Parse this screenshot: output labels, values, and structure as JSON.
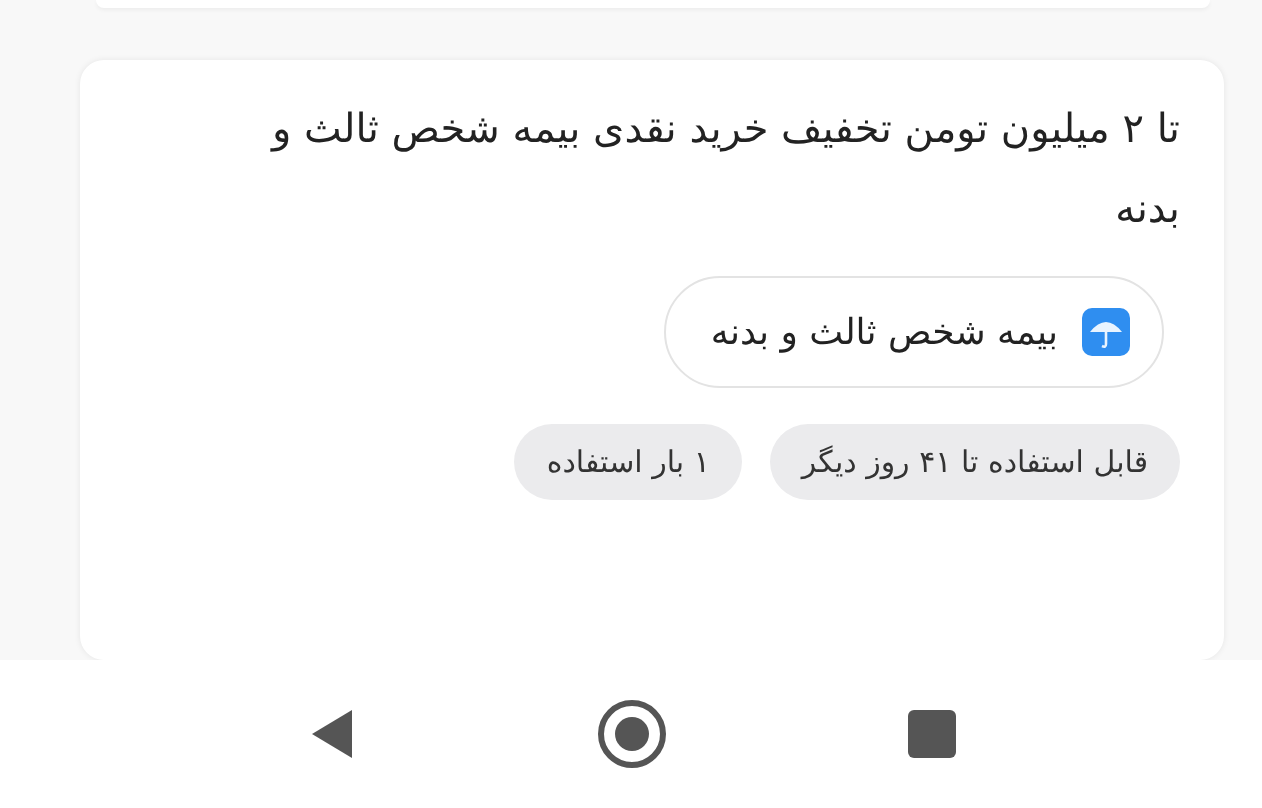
{
  "offer": {
    "title": "تا ۲ میلیون تومن تخفیف خرید نقدی بیمه شخص ثالث و بدنه",
    "category": {
      "label": "بیمه شخص ثالث و بدنه"
    },
    "tags": [
      "قابل استفاده تا ۴۱ روز دیگر",
      "۱ بار استفاده"
    ]
  },
  "nav_bar": {
    "buttons": [
      {
        "kind": "back"
      },
      {
        "kind": "home"
      },
      {
        "kind": "recents"
      }
    ]
  }
}
